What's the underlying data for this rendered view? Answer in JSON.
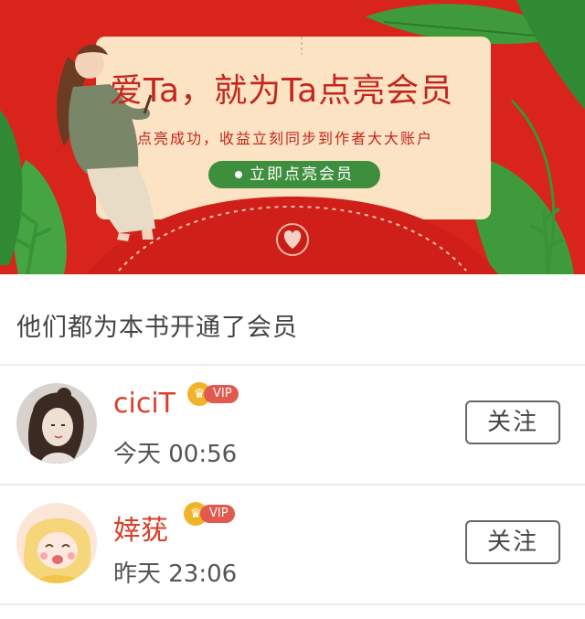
{
  "banner": {
    "headline": "爱Ta，就为Ta点亮会员",
    "subline": "点亮成功，收益立刻同步到作者大大账户",
    "cta_label": "立即点亮会员"
  },
  "section": {
    "title": "他们都为本书开通了会员"
  },
  "members": [
    {
      "name": "ciciT",
      "vip": "VIP",
      "time": "今天 00:56",
      "follow_label": "关注"
    },
    {
      "name": "婞莸",
      "vip": "VIP",
      "time": "昨天 23:06",
      "follow_label": "关注"
    }
  ],
  "colors": {
    "banner_red": "#d9241c",
    "card_cream": "#fbe3c4",
    "cta_green": "#3d8f3d",
    "name_red": "#d9402b"
  }
}
